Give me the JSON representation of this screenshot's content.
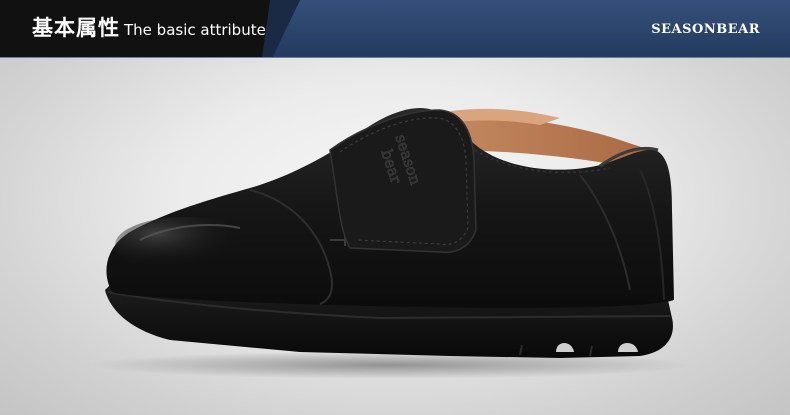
{
  "header": {
    "title_cn": "基本属性",
    "title_en": "The basic attribute",
    "brand": "SEASONBEAR"
  },
  "product": {
    "icon": "shoe-image",
    "logo_text": "season bear"
  },
  "colors": {
    "header_dark": "#111111",
    "header_blue": "#2c4266",
    "shoe": "#141414"
  }
}
